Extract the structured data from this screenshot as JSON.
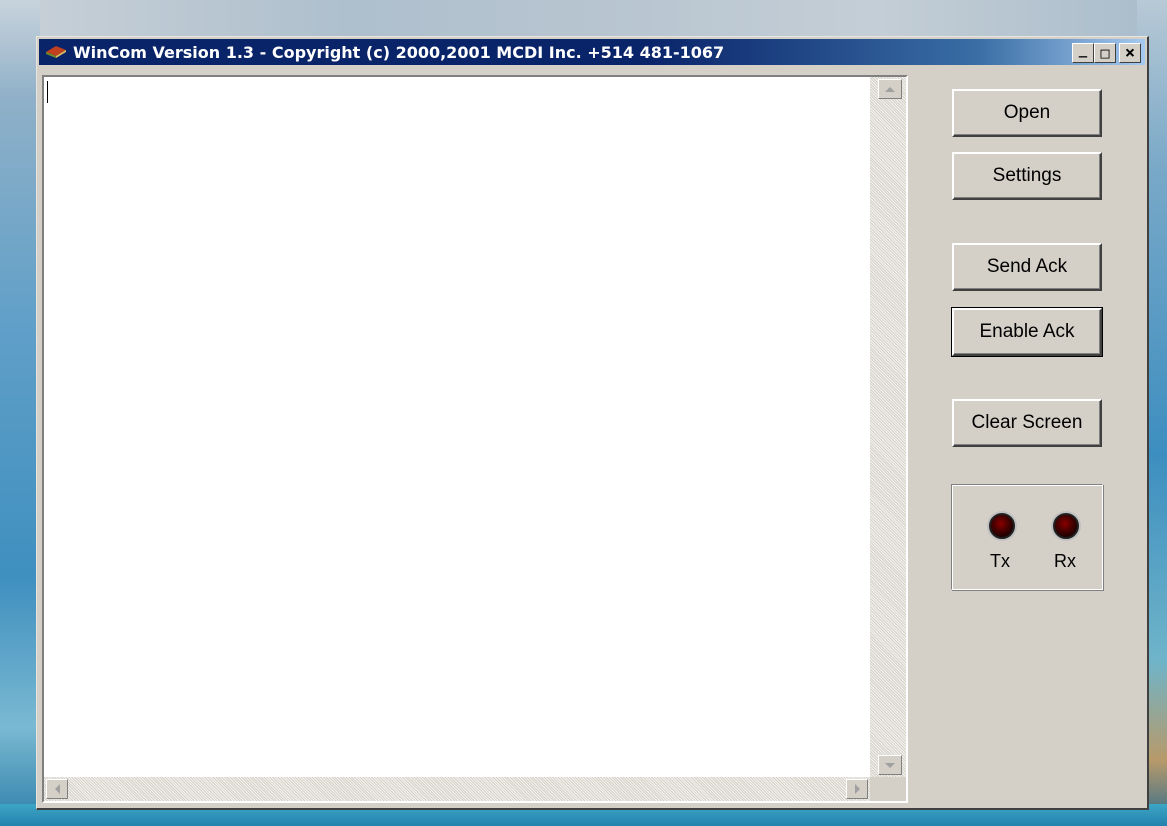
{
  "window": {
    "title": "WinCom  Version 1.3 - Copyright (c) 2000,2001 MCDI Inc.  +514 481-1067",
    "controls": {
      "minimize": "_",
      "maximize": "□",
      "close": "×"
    }
  },
  "terminal": {
    "text": ""
  },
  "buttons": {
    "open": "Open",
    "settings": "Settings",
    "send_ack": "Send Ack",
    "enable_ack": "Enable Ack",
    "clear_screen": "Clear Screen"
  },
  "indicators": [
    {
      "label": "Tx",
      "state": "off",
      "color": "#8a0000"
    },
    {
      "label": "Rx",
      "state": "off",
      "color": "#8a0000"
    }
  ],
  "icons": [
    "app-icon",
    "minimize-icon",
    "maximize-icon",
    "close-icon",
    "scroll-up-icon",
    "scroll-down-icon",
    "scroll-left-icon",
    "scroll-right-icon"
  ],
  "colors": {
    "titlebar": "#0a246a",
    "face": "#d4d0c8",
    "led_off": "#4a0000"
  }
}
